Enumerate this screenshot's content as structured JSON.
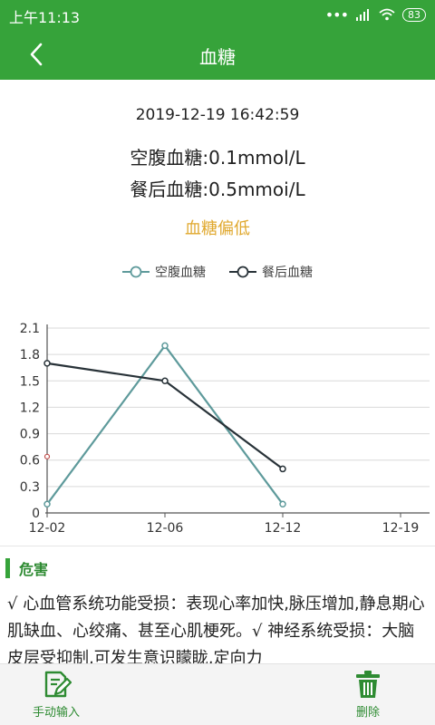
{
  "status_bar": {
    "time": "上午11:13",
    "battery": "83"
  },
  "app_bar": {
    "title": "血糖"
  },
  "record": {
    "time": "2019-12-19 16:42:59",
    "fasting_line": "空腹血糖:0.1mmol/L",
    "post_line": "餐后血糖:0.5mmoi/L",
    "status": "血糖偏低"
  },
  "colors": {
    "primary": "#36a33a",
    "warning": "#e0a82e",
    "fasting_series": "#5e9a9b",
    "post_series": "#283238"
  },
  "chart_data": {
    "type": "line",
    "legend": [
      "空腹血糖",
      "餐后血糖"
    ],
    "legend_placement": "top-center",
    "categories": [
      "12-02",
      "12-06",
      "12-12",
      "12-19"
    ],
    "series": [
      {
        "name": "空腹血糖",
        "values": [
          0.1,
          1.9,
          0.1
        ]
      },
      {
        "name": "餐后血糖",
        "values": [
          1.7,
          1.5,
          0.5
        ]
      }
    ],
    "y_ticks": [
      "0",
      "0.3",
      "0.6",
      "0.9",
      "1.2",
      "1.5",
      "1.8",
      "2.1"
    ],
    "ylim": [
      0,
      2.1
    ],
    "grid": true
  },
  "harm": {
    "title": "危害",
    "text": "√ 心血管系统功能受损：表现心率加快,脉压增加,静息期心肌缺血、心绞痛、甚至心肌梗死。√ 神经系统受损：大脑皮层受抑制,可发生意识矇眬,定向力"
  },
  "bottom": {
    "manual_label": "手动输入",
    "delete_label": "删除"
  }
}
